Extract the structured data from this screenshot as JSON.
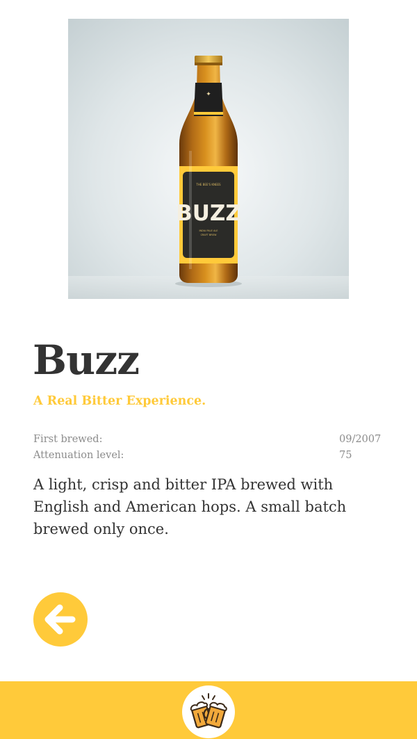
{
  "beer": {
    "name": "Buzz",
    "tagline": "A Real Bitter Experience.",
    "bottle_label": "BUZZ",
    "description": "A light, crisp and bitter IPA brewed with English and American hops. A small batch brewed only once."
  },
  "stats": [
    {
      "label": "First brewed:",
      "value": "09/2007"
    },
    {
      "label": "Attenuation level:",
      "value": "75"
    }
  ],
  "icons": {
    "back": "arrow-left-icon",
    "logo": "beer-mugs-cheers-icon"
  },
  "colors": {
    "accent": "#FFCA3A",
    "text_dark": "#333333",
    "text_muted": "#8c8c8c",
    "background": "#ffffff"
  }
}
